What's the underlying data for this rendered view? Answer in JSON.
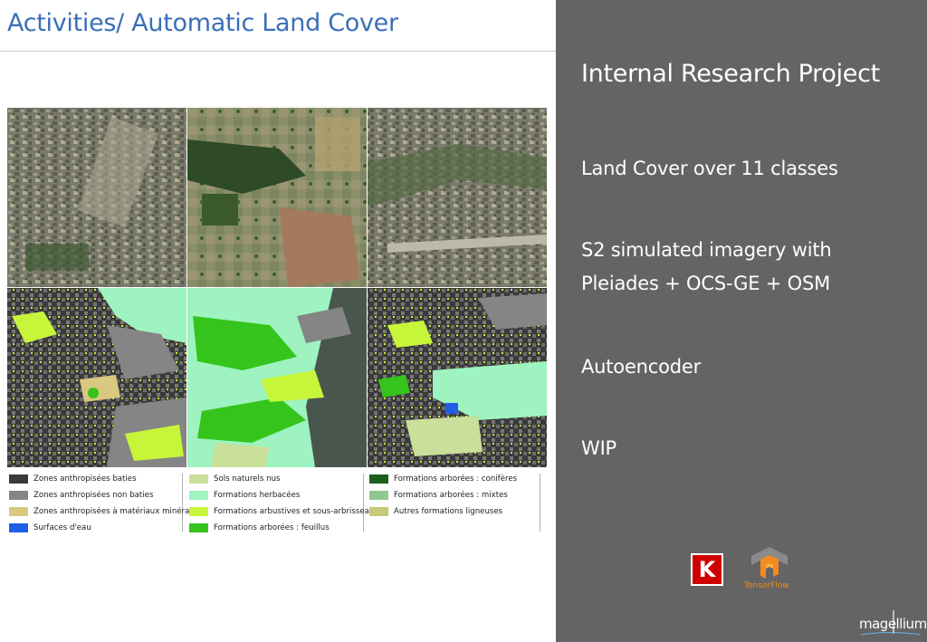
{
  "slide": {
    "title": "Activities/ Automatic Land Cover"
  },
  "panel": {
    "heading": "Internal Research Project",
    "items": [
      "Land Cover over 11 classes",
      "S2 simulated imagery with",
      "Pleiades + OCS-GE + OSM",
      "Autoencoder",
      "WIP"
    ]
  },
  "legend": {
    "items": [
      {
        "label": "Zones anthropisées baties",
        "color": "#3a3a3a"
      },
      {
        "label": "Zones anthropisées non baties",
        "color": "#858585"
      },
      {
        "label": "Zones anthropisées à matériaux minéraux",
        "color": "#d8c880"
      },
      {
        "label": "Surfaces d'eau",
        "color": "#1f5fe8"
      },
      {
        "label": "Sols naturels nus",
        "color": "#c9df9a"
      },
      {
        "label": "Formations herbacées",
        "color": "#9ef3c0"
      },
      {
        "label": "Formations arbustives et sous-arbrisseaux",
        "color": "#c6f53a"
      },
      {
        "label": "Formations arborées : feuillus",
        "color": "#35c41c"
      },
      {
        "label": "Formations arborées : conifères",
        "color": "#1c5f1c"
      },
      {
        "label": "Formations arborées : mixtes",
        "color": "#8fc88f"
      },
      {
        "label": "Autres formations ligneuses",
        "color": "#c8c878"
      }
    ]
  },
  "logos": {
    "keras_letter": "K",
    "tensorflow_word": "TensorFlow",
    "brand_word": "magellium"
  }
}
